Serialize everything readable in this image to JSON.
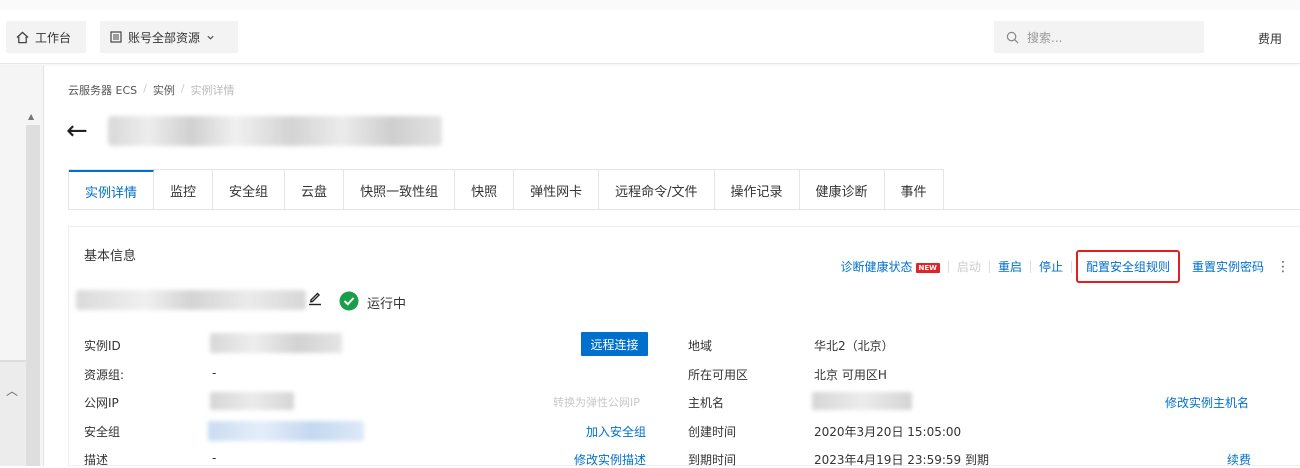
{
  "topbar": {
    "workbench_label": "工作台",
    "resources_label": "账号全部资源",
    "search_placeholder": "搜索...",
    "fee_label": "费用"
  },
  "breadcrumb": [
    "云服务器 ECS",
    "实例",
    "实例详情"
  ],
  "tabs": [
    "实例详情",
    "监控",
    "安全组",
    "云盘",
    "快照一致性组",
    "快照",
    "弹性网卡",
    "远程命令/文件",
    "操作记录",
    "健康诊断",
    "事件"
  ],
  "card": {
    "title": "基本信息",
    "actions": {
      "diagnose": "诊断健康状态",
      "diagnose_badge": "NEW",
      "start": "启动",
      "restart": "重启",
      "stop": "停止",
      "config_sg": "配置安全组规则",
      "reset_pwd": "重置实例密码"
    },
    "status": "运行中",
    "colors": {
      "accent": "#0070cc",
      "running": "#1a9e4a",
      "highlight_border": "#e02020"
    }
  },
  "info": {
    "instance_id_label": "实例ID",
    "connect_button": "远程连接",
    "region_label": "地域",
    "region_value": "华北2（北京）",
    "resource_group_label": "资源组:",
    "resource_group_value": "-",
    "zone_label": "所在可用区",
    "zone_value": "北京 可用区H",
    "public_ip_label": "公网IP",
    "convert_eip_link": "转换为弹性公网IP",
    "hostname_label": "主机名",
    "modify_hostname_link": "修改实例主机名",
    "security_group_label": "安全组",
    "join_sg_link": "加入安全组",
    "created_label": "创建时间",
    "created_value": "2020年3月20日 15:05:00",
    "desc_label": "描述",
    "desc_value": "-",
    "modify_desc_link": "修改实例描述",
    "expire_label": "到期时间",
    "expire_value": "2023年4月19日 23:59:59 到期",
    "renew_link": "续费"
  }
}
